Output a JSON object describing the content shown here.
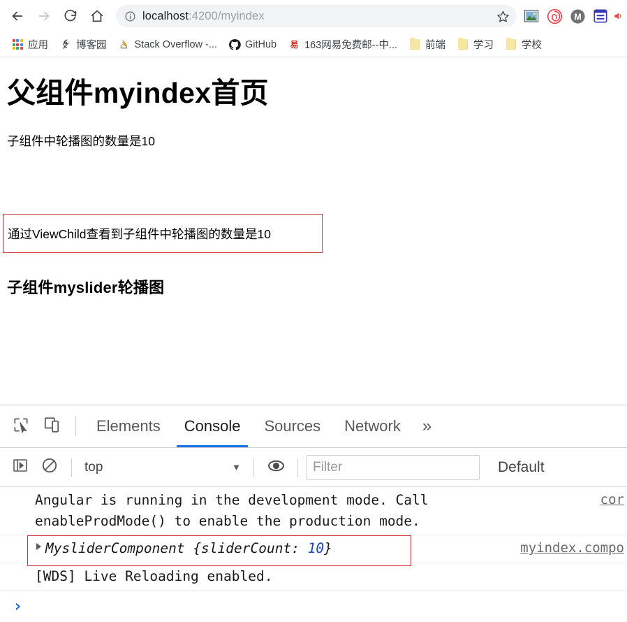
{
  "browser": {
    "nav": {
      "back": "back-arrow",
      "forward": "forward-arrow",
      "reload": "reload-arrow",
      "home": "home-house"
    },
    "omnibox": {
      "info_icon": "page-info-icon",
      "host": "localhost",
      "path": ":4200/myindex",
      "full_url": "localhost:4200/myindex",
      "bookmark_icon": "star-outline-icon"
    },
    "extensions": [
      {
        "name": "image-capture-extension",
        "glyph": "picture"
      },
      {
        "name": "spiral-extension",
        "glyph": "spiral",
        "color": "#ef4050"
      },
      {
        "name": "m-circle-extension",
        "glyph": "M",
        "color": "#707070"
      },
      {
        "name": "notes-extension",
        "glyph": "list",
        "color": "#3b3bb0"
      },
      {
        "name": "red-edge-extension",
        "glyph": "speaker",
        "color": "#e8443d"
      }
    ],
    "bookmarks": [
      {
        "label": "应用",
        "icon": "apps-grid-icon"
      },
      {
        "label": "博客园",
        "icon": "cnblogs-icon"
      },
      {
        "label": "Stack Overflow -...",
        "icon": "stackoverflow-icon"
      },
      {
        "label": "GitHub",
        "icon": "github-icon"
      },
      {
        "label": "163网易免费邮--中...",
        "icon": "netease-icon"
      },
      {
        "label": "前端",
        "icon": "folder-icon"
      },
      {
        "label": "学习",
        "icon": "folder-icon"
      },
      {
        "label": "学校",
        "icon": "folder-icon"
      }
    ]
  },
  "page": {
    "heading": "父组件myindex首页",
    "child_count_text": "子组件中轮播图的数量是10",
    "viewchild_text": "通过ViewChild查看到子组件中轮播图的数量是10",
    "child_heading": "子组件myslider轮播图",
    "annotation_color": "#cc3a42"
  },
  "devtools": {
    "tools": [
      {
        "name": "inspect-element-icon"
      },
      {
        "name": "device-toolbar-icon"
      }
    ],
    "tabs": [
      {
        "label": "Elements",
        "active": false
      },
      {
        "label": "Console",
        "active": true
      },
      {
        "label": "Sources",
        "active": false
      },
      {
        "label": "Network",
        "active": false
      }
    ],
    "more_tabs": "»",
    "console_toolbar": {
      "sidebar_toggle_icon": "console-sidebar-icon",
      "clear_icon": "clear-console-icon",
      "context": "top",
      "context_caret": "▼",
      "eye_icon": "live-expression-icon",
      "filter_placeholder": "Filter",
      "levels_label": "Default"
    },
    "messages": [
      {
        "text": "Angular is running in the development mode. Call\nenableProdMode() to enable the production mode.",
        "source": "cor",
        "type": "log",
        "expandable": false
      },
      {
        "text": "MysliderComponent {sliderCount: ",
        "value": "10",
        "text_end": "}",
        "source": "myindex.compo",
        "type": "object",
        "expandable": true,
        "highlighted": true
      },
      {
        "text": "[WDS] Live Reloading enabled.",
        "source": "",
        "type": "log",
        "expandable": false
      }
    ],
    "prompt": "›"
  }
}
